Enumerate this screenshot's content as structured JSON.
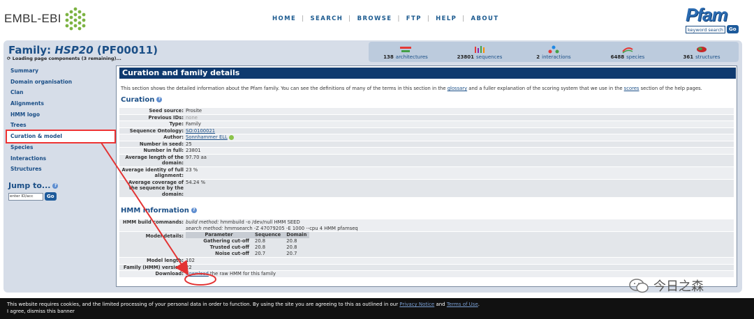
{
  "header": {
    "embl_text": "EMBL-EBI",
    "nav": [
      "HOME",
      "SEARCH",
      "BROWSE",
      "FTP",
      "HELP",
      "ABOUT"
    ],
    "pfam_logo": "Pfam",
    "keyword_search": "keyword search",
    "go": "Go"
  },
  "family": {
    "prefix": "Family: ",
    "name": "HSP20",
    "accession": " (PF00011)",
    "loading": "Loading page components (3 remaining)..."
  },
  "stats": [
    {
      "num": "138",
      "label": "architectures",
      "icon": "architectures-icon"
    },
    {
      "num": "23801",
      "label": "sequences",
      "icon": "sequences-icon"
    },
    {
      "num": "2",
      "label": "interactions",
      "icon": "interactions-icon"
    },
    {
      "num": "6488",
      "label": "species",
      "icon": "species-icon"
    },
    {
      "num": "361",
      "label": "structures",
      "icon": "structures-icon"
    }
  ],
  "sidebar": {
    "items": [
      "Summary",
      "Domain organisation",
      "Clan",
      "Alignments",
      "HMM logo",
      "Trees",
      "Curation & model",
      "Species",
      "Interactions",
      "Structures"
    ],
    "active_index": 6,
    "jump_title": "Jump to...",
    "jump_placeholder": "enter ID/acc",
    "go": "Go"
  },
  "panel": {
    "title": "Curation and family details",
    "intro_pre": "This section shows the detailed information about the Pfam family. You can see the definitions of many of the terms in this section in the ",
    "intro_link1": "glossary",
    "intro_mid": " and a fuller explanation of the scoring system that we use in the ",
    "intro_link2": "scores",
    "intro_post": " section of the help pages.",
    "curation_heading": "Curation",
    "curation": {
      "seed_source_label": "Seed source:",
      "seed_source": "Prosite",
      "prev_ids_label": "Previous IDs:",
      "prev_ids": "none",
      "type_label": "Type:",
      "type": "Family",
      "so_label": "Sequence Ontology:",
      "so": "SO:0100021",
      "author_label": "Author:",
      "author": "Sonnhammer ELL",
      "seed_num_label": "Number in seed:",
      "seed_num": "25",
      "full_num_label": "Number in full:",
      "full_num": "23801",
      "avg_len_label": "Average length of the domain:",
      "avg_len": "97.70 aa",
      "avg_id_label": "Average identity of full alignment:",
      "avg_id": "23 %",
      "avg_cov_label": "Average coverage of the sequence by the domain:",
      "avg_cov": "54.24 %"
    },
    "hmm_heading": "HMM information",
    "hmm": {
      "build_label": "HMM build commands:",
      "build_method_label": "build method:",
      "build_method": "hmmbuild -o /dev/null HMM SEED",
      "search_method_label": "search method:",
      "search_method": "hmmsearch -Z 47079205 -E 1000 --cpu 4 HMM pfamseq",
      "model_details_label": "Model details:",
      "cut_headers": [
        "Parameter",
        "Sequence",
        "Domain"
      ],
      "cut_rows": [
        {
          "name": "Gathering cut-off",
          "seq": "20.8",
          "dom": "20.8"
        },
        {
          "name": "Trusted cut-off",
          "seq": "20.8",
          "dom": "20.8"
        },
        {
          "name": "Noise cut-off",
          "seq": "20.7",
          "dom": "20.7"
        }
      ],
      "model_length_label": "Model length:",
      "model_length": "102",
      "version_label": "Family (HMM) version:",
      "version": "22",
      "download_label": "Download:",
      "download_link": "download",
      "download_text": " the raw HMM for this family"
    }
  },
  "cookie": {
    "line1_pre": "This website requires cookies, and the limited processing of your personal data in order to function. By using the site you are agreeing to this as outlined in our ",
    "privacy": "Privacy Notice",
    "and": " and ",
    "terms": "Terms of Use",
    "end": ".",
    "line2": "I agree, dismiss this banner"
  },
  "watermark": "今日之森",
  "colors": {
    "accent": "#1b4f87",
    "header": "#0f3a6f",
    "annotation": "#e33333"
  }
}
